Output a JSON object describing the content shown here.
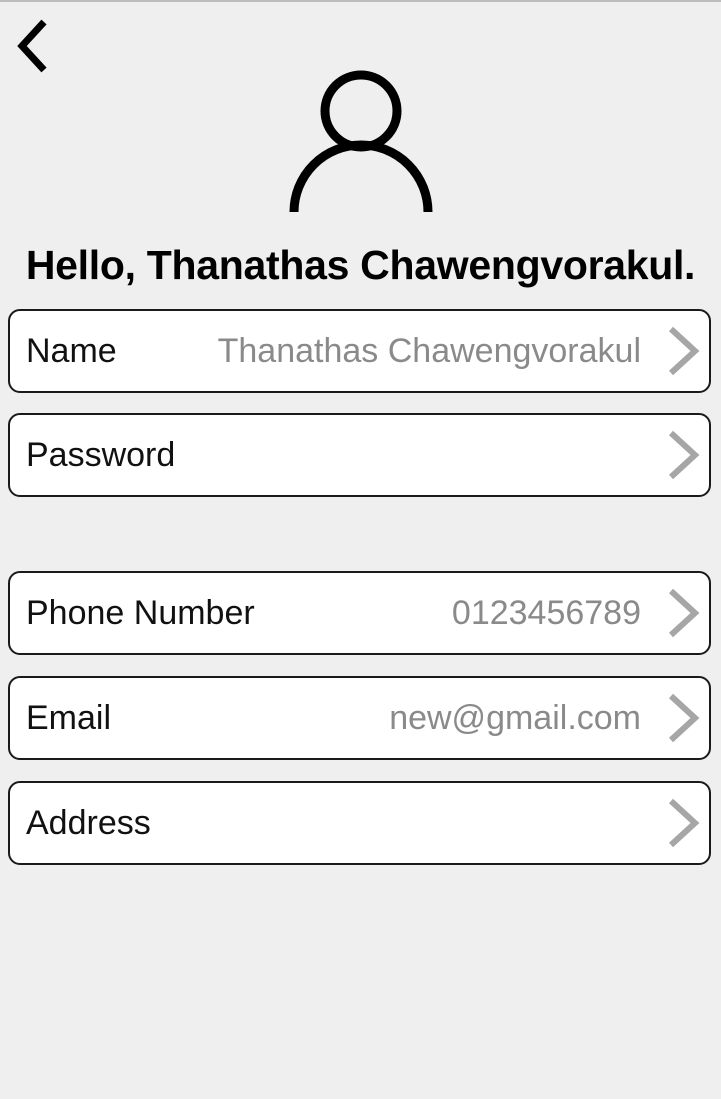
{
  "header": {
    "back_icon": "chevron-left-icon",
    "avatar_icon": "user-profile-icon",
    "greeting": "Hello, Thanathas Chawengvorakul."
  },
  "profile": {
    "rows": [
      {
        "label": "Name",
        "value": "Thanathas Chawengvorakul",
        "icon": "chevron-right-icon"
      },
      {
        "label": "Password",
        "value": "",
        "icon": "chevron-right-icon"
      },
      {
        "label": "Phone Number",
        "value": "0123456789",
        "icon": "chevron-right-icon"
      },
      {
        "label": "Email",
        "value": "new@gmail.com",
        "icon": "chevron-right-icon"
      },
      {
        "label": "Address",
        "value": "",
        "icon": "chevron-right-icon"
      }
    ]
  },
  "colors": {
    "background": "#efefef",
    "row_background": "#ffffff",
    "row_border": "#1a1a1a",
    "value_text": "#8a8a8a",
    "chevron": "#a6a6a6"
  }
}
